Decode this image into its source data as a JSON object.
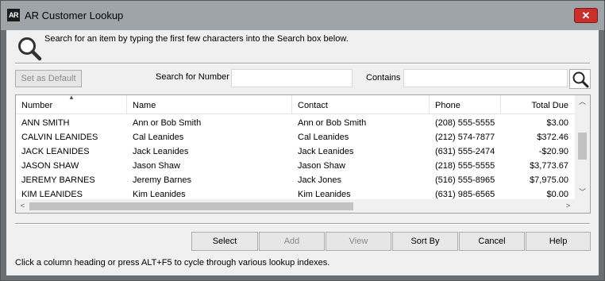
{
  "window": {
    "title": "AR Customer Lookup",
    "icon_text": "AR",
    "close_glyph": "✕"
  },
  "instruction": "Search for an item by typing the first few characters into the Search box below.",
  "search": {
    "set_default_label": "Set as Default",
    "search_for_label": "Search for Number",
    "search_value": "",
    "contains_label": "Contains",
    "contains_value": ""
  },
  "grid": {
    "columns": [
      "Number",
      "Name",
      "Contact",
      "Phone",
      "Total Due"
    ],
    "sort_indicator": "▲",
    "rows": [
      [
        "ANN SMITH",
        "Ann or Bob Smith",
        "Ann or Bob Smith",
        "(208) 555-5555",
        "$3.00"
      ],
      [
        "CALVIN LEANIDES",
        "Cal Leanides",
        "Cal Leanides",
        "(212) 574-7877",
        "$372.46"
      ],
      [
        "JACK LEANIDES",
        "Jack Leanides",
        "Jack Leanides",
        "(631) 555-2474",
        "-$20.90"
      ],
      [
        "JASON SHAW",
        "Jason Shaw",
        "Jason Shaw",
        "(218) 555-5555",
        "$3,773.67"
      ],
      [
        "JEREMY BARNES",
        "Jeremy Barnes",
        "Jack Jones",
        "(516) 555-8965",
        "$7,975.00"
      ],
      [
        "KIM LEANIDES",
        "Kim Leanides",
        "Kim Leanides",
        "(631) 985-6565",
        "$0.00"
      ]
    ],
    "scroll": {
      "up": "︿",
      "down": "﹀",
      "left": "<",
      "right": ">",
      "vertical_position": 0.4,
      "horizontal_position": 0.0
    }
  },
  "buttons": {
    "select": "Select",
    "add": "Add",
    "view": "View",
    "sort_by": "Sort By",
    "cancel": "Cancel",
    "help": "Help"
  },
  "status": "Click a column heading or press ALT+F5 to cycle through various lookup indexes.",
  "colors": {
    "titlebar": "#9fa4a8",
    "close": "#c9302c",
    "client": "#f0f0f0",
    "frame": "#6a6f73"
  }
}
